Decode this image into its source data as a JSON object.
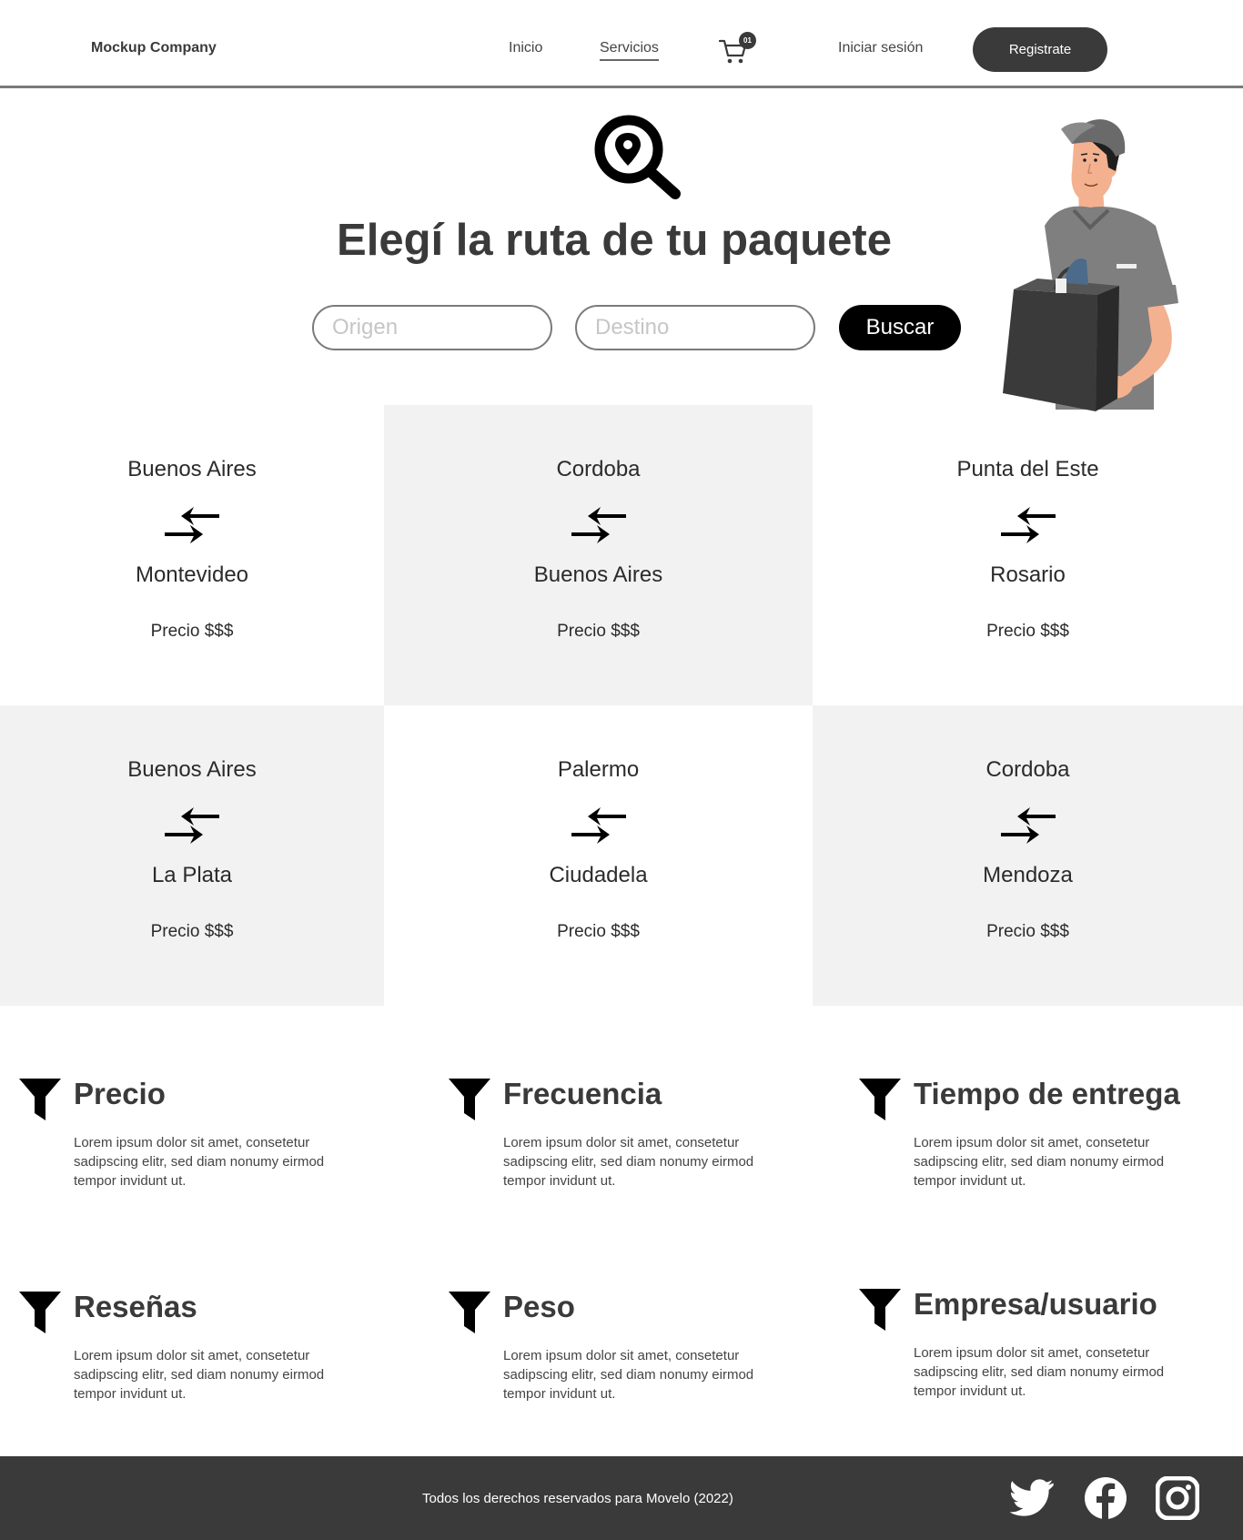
{
  "header": {
    "company": "Mockup Company",
    "nav": {
      "inicio": "Inicio",
      "servicios": "Servicios"
    },
    "cart_badge": "01",
    "login": "Iniciar sesión",
    "register": "Registrate"
  },
  "hero": {
    "title": "Elegí la ruta de tu paquete",
    "origin_placeholder": "Origen",
    "destination_placeholder": "Destino",
    "search_button": "Buscar"
  },
  "routes": [
    {
      "from": "Buenos Aires",
      "to": "Montevideo",
      "price": "Precio $$$"
    },
    {
      "from": "Cordoba",
      "to": "Buenos Aires",
      "price": "Precio $$$"
    },
    {
      "from": "Punta del Este",
      "to": "Rosario",
      "price": "Precio $$$"
    },
    {
      "from": "Buenos Aires",
      "to": "La Plata",
      "price": "Precio $$$"
    },
    {
      "from": "Palermo",
      "to": "Ciudadela",
      "price": "Precio $$$"
    },
    {
      "from": "Cordoba",
      "to": "Mendoza",
      "price": "Precio $$$"
    }
  ],
  "filters": [
    {
      "title": "Precio",
      "text": "Lorem ipsum dolor sit amet, consetetur sadipscing elitr, sed diam nonumy eirmod tempor invidunt ut."
    },
    {
      "title": "Frecuencia",
      "text": "Lorem ipsum dolor sit amet, consetetur sadipscing elitr, sed diam nonumy eirmod tempor invidunt ut."
    },
    {
      "title": "Tiempo de entrega",
      "text": "Lorem ipsum dolor sit amet, consetetur sadipscing elitr, sed diam nonumy eirmod tempor invidunt ut."
    },
    {
      "title": "Reseñas",
      "text": "Lorem ipsum dolor sit amet, consetetur sadipscing elitr, sed diam nonumy eirmod tempor invidunt ut."
    },
    {
      "title": "Peso",
      "text": "Lorem ipsum dolor sit amet, consetetur sadipscing elitr, sed diam nonumy eirmod tempor invidunt ut."
    },
    {
      "title": "Empresa/usuario",
      "text": "Lorem ipsum dolor sit amet, consetetur sadipscing elitr, sed diam nonumy eirmod tempor invidunt ut."
    }
  ],
  "footer": {
    "copyright": "Todos los derechos reservados para Movelo (2022)",
    "social_icons": [
      "twitter-icon",
      "facebook-icon",
      "instagram-icon"
    ]
  },
  "colors": {
    "dark": "#3a3a3a",
    "card_gray": "#f2f2f2",
    "black": "#000000"
  }
}
